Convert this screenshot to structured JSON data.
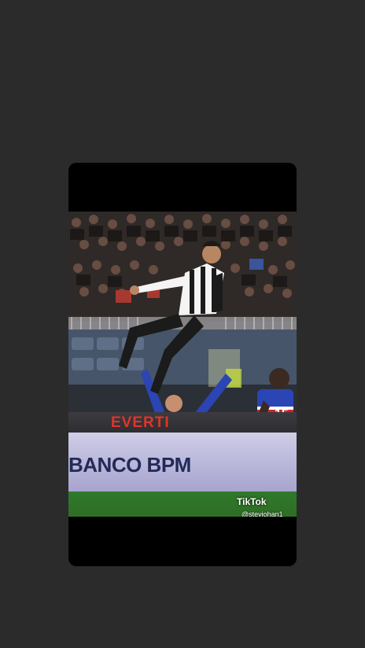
{
  "background_watermark": {
    "text": "",
    "sub": ""
  },
  "photo": {
    "board_red_text": "EVERTI",
    "board_banco_text": "BANCO BPM",
    "tiktok_label": "TikTok",
    "handle": "@stevjohan1"
  },
  "colors": {
    "page_bg": "#2b2b2b",
    "card_bg": "#000000",
    "juventus_stripes": "#ffffff",
    "sampdoria_blue": "#2b45b5",
    "pitch": "#2e7a2a"
  }
}
